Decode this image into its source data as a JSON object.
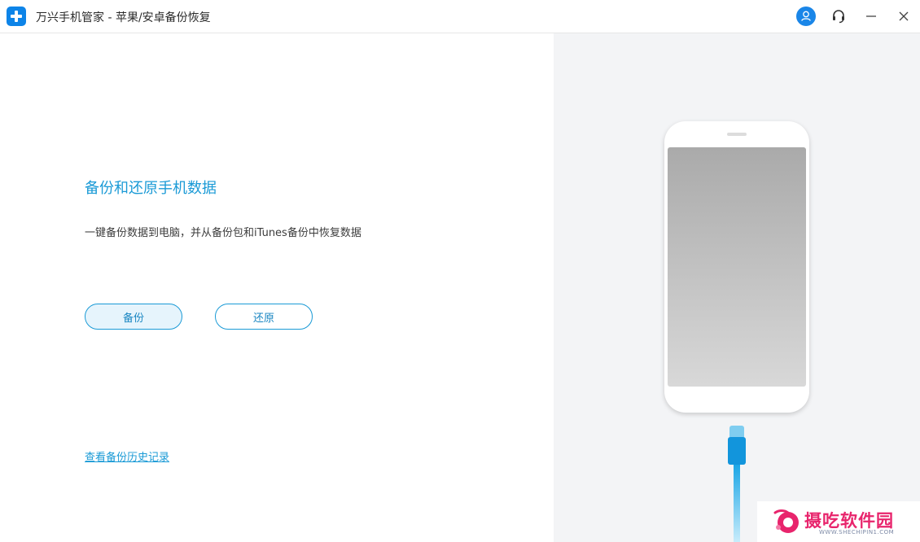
{
  "window": {
    "title": "万兴手机管家 - 苹果/安卓备份恢复",
    "buttons": [
      "user-icon",
      "headset-icon",
      "minimize-icon",
      "close-icon"
    ]
  },
  "main": {
    "headline": "备份和还原手机数据",
    "subtitle": "一键备份数据到电脑，并从备份包和iTunes备份中恢复数据",
    "backup_button": "备份",
    "restore_button": "还原",
    "history_link": "查看备份历史记录"
  },
  "watermark": {
    "text": "摄吃软件园",
    "sub": "WWW.SHECHIPIN1.COM"
  },
  "colors": {
    "accent": "#1a9ad6",
    "logo": "#0d84e8",
    "right_pane_bg": "#f3f4f6",
    "watermark": "#e8246c"
  }
}
